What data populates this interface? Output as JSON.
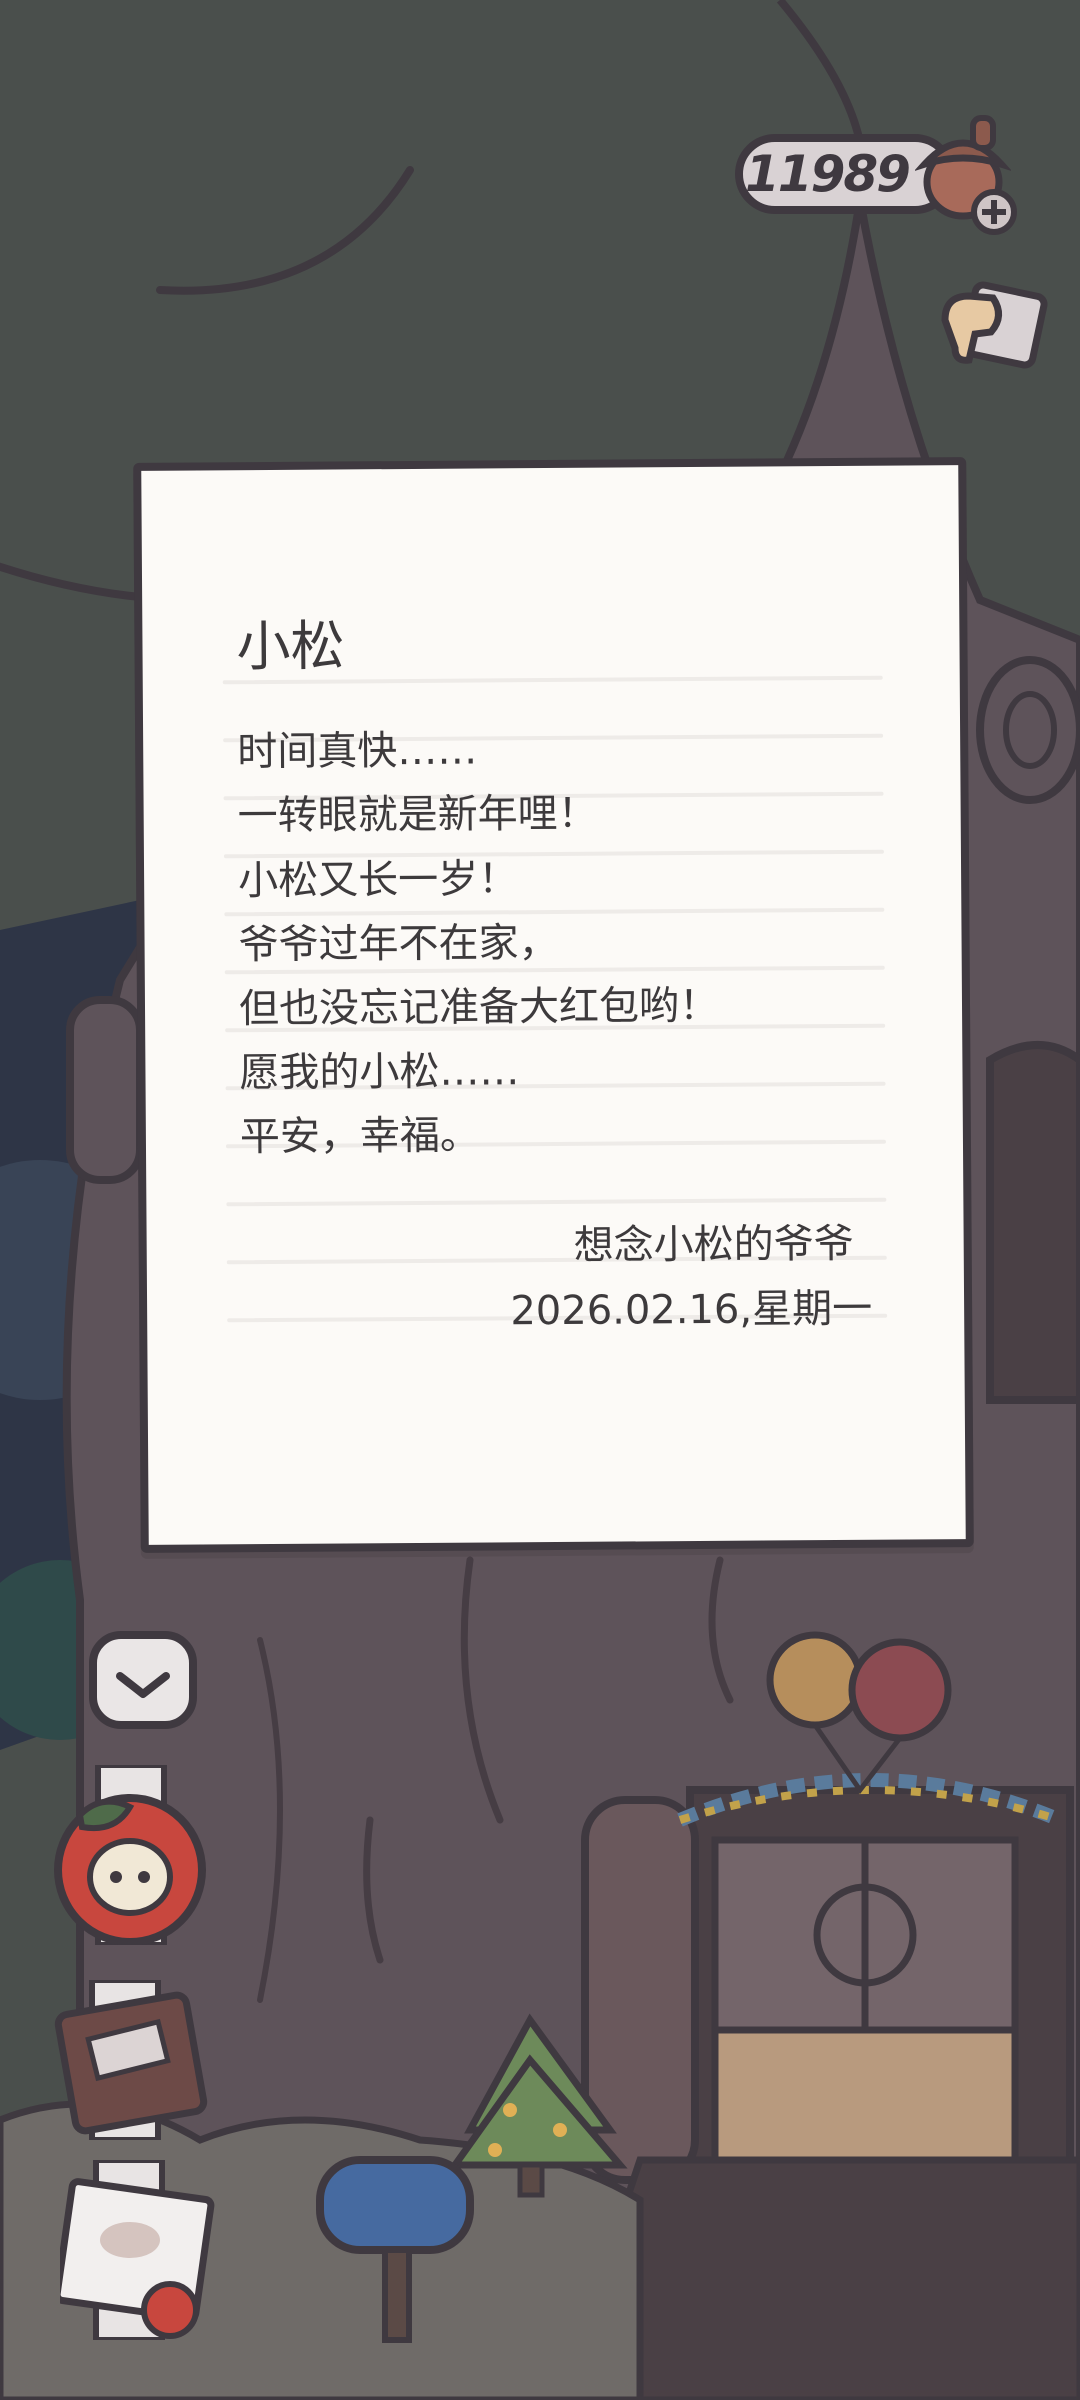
{
  "hud": {
    "acorn_count": "11989",
    "icons": [
      "acorn-icon",
      "plus-icon",
      "hint-hand-icon"
    ]
  },
  "letter": {
    "greeting": "小松",
    "lines": [
      "时间真快……",
      "一转眼就是新年哩！",
      "小松又长一岁！",
      "爷爷过年不在家，",
      "但也没忘记准备大红包哟！",
      "愿我的小松……",
      "平安，幸福。"
    ],
    "signature": "想念小松的爷爷",
    "date": "2026.02.16,星期一"
  },
  "sidebar": {
    "icons": [
      "collapse-chevron-icon",
      "apple-avatar-icon",
      "notebook-icon",
      "scroll-icon"
    ]
  },
  "colors": {
    "outline": "#3f3940",
    "paper": "#fcfaf7",
    "sky": "#4a4f4c",
    "tree_trunk": "#5e535a",
    "rule_line": "#eeebe8"
  }
}
